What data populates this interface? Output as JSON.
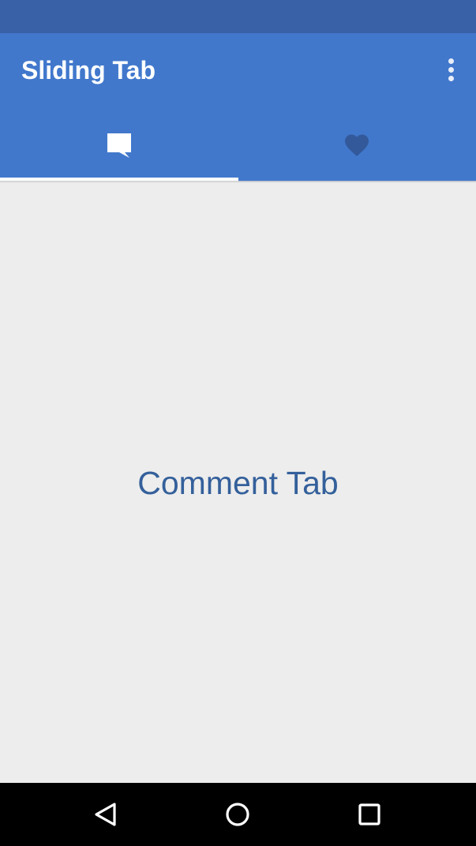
{
  "app": {
    "title": "Sliding Tab",
    "overflow_icon": "more-vert-icon"
  },
  "tabs": [
    {
      "icon": "comment-icon",
      "selected": true
    },
    {
      "icon": "heart-icon",
      "selected": false
    }
  ],
  "content": {
    "label": "Comment Tab"
  },
  "nav": {
    "back_icon": "back-triangle-icon",
    "home_icon": "home-circle-icon",
    "recents_icon": "recents-square-icon"
  },
  "colors": {
    "status_bar": "#3961a8",
    "app_bar": "#4178cc",
    "content_bg": "#ededed",
    "content_text": "#34609b",
    "inactive_tab_icon": "#33599a",
    "indicator": "#ffffff"
  }
}
